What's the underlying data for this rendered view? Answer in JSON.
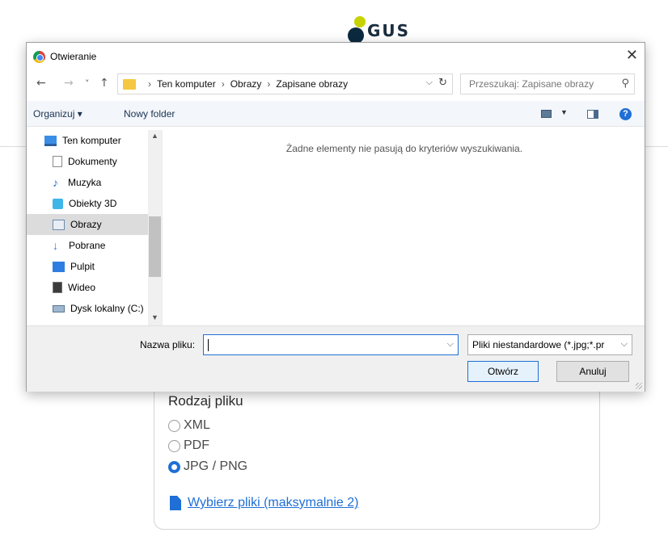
{
  "page": {
    "logo_text": "GUS",
    "file_type_title": "Rodzaj pliku",
    "file_types": [
      {
        "label": "XML",
        "checked": false
      },
      {
        "label": "PDF",
        "checked": false
      },
      {
        "label": "JPG / PNG",
        "checked": true
      }
    ],
    "choose_files_link": "Wybierz pliki (maksymalnie 2)",
    "accent_color": "#1f6fd6"
  },
  "dialog": {
    "title": "Otwieranie",
    "close_glyph": "✕",
    "nav": {
      "back": "←",
      "forward": "→",
      "recent": "˅",
      "up": "↑"
    },
    "breadcrumb": [
      "Ten komputer",
      "Obrazy",
      "Zapisane obrazy"
    ],
    "breadcrumb_sep": "›",
    "dropdown_glyph": "⌵",
    "refresh_glyph": "↻",
    "search_placeholder": "Przeszukaj: Zapisane obrazy",
    "search_glyph": "⚲",
    "toolbar": {
      "organize": "Organizuj ▾",
      "new_folder": "Nowy folder",
      "help": "?",
      "view_dropdown": "▼"
    },
    "sidebar": [
      {
        "label": "Ten komputer",
        "icon": "computer-icon",
        "selected": false
      },
      {
        "label": "Dokumenty",
        "icon": "documents-icon",
        "selected": false
      },
      {
        "label": "Muzyka",
        "icon": "music-icon",
        "selected": false
      },
      {
        "label": "Obiekty 3D",
        "icon": "objects-3d-icon",
        "selected": false
      },
      {
        "label": "Obrazy",
        "icon": "pictures-icon",
        "selected": true
      },
      {
        "label": "Pobrane",
        "icon": "downloads-icon",
        "selected": false
      },
      {
        "label": "Pulpit",
        "icon": "desktop-icon",
        "selected": false
      },
      {
        "label": "Wideo",
        "icon": "video-icon",
        "selected": false
      },
      {
        "label": "Dysk lokalny (C:)",
        "icon": "local-disk-icon",
        "selected": false
      }
    ],
    "scroll": {
      "up": "▲",
      "down": "▼"
    },
    "empty_message": "Żadne elementy nie pasują do kryteriów wyszukiwania.",
    "filename_label": "Nazwa pliku:",
    "filename_value": "",
    "filter_value": "Pliki niestandardowe (*.jpg;*.pr",
    "open_button": "Otwórz",
    "cancel_button": "Anuluj"
  }
}
